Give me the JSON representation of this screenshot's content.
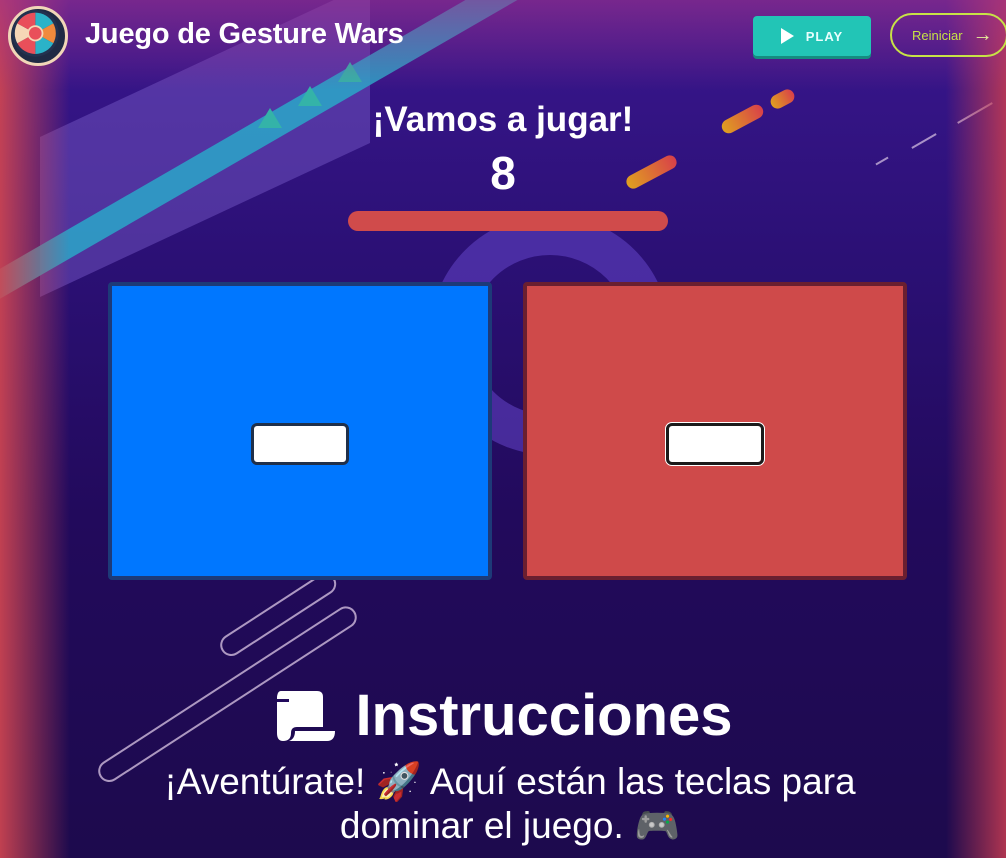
{
  "header": {
    "title": "Juego de Gesture Wars",
    "play_label": "PLAY",
    "restart_label": "Reiniciar",
    "play_icon": "play-icon",
    "restart_icon": "arrow-right-icon"
  },
  "game": {
    "title": "¡Vamos a jugar!",
    "countdown": "8",
    "timer_fraction": 1.0,
    "players": [
      {
        "color": "#0077ff",
        "key_value": ""
      },
      {
        "color": "#cf4a4a",
        "key_value": ""
      }
    ]
  },
  "instructions": {
    "title": "Instrucciones",
    "icon": "scroll-icon",
    "text": "¡Aventúrate! 🚀 Aquí están las teclas para dominar el juego. 🎮"
  },
  "colors": {
    "play_button": "#22c5b6",
    "restart_border": "#c7e246",
    "timer_bar": "#d04b4b",
    "background": "#220a5c"
  }
}
